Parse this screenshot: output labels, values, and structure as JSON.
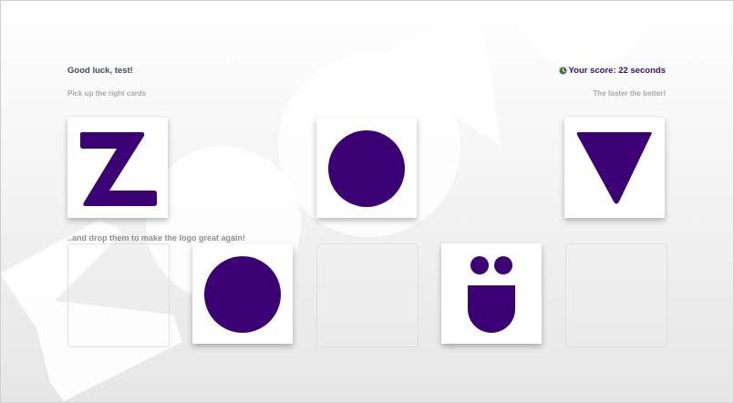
{
  "header": {
    "greeting": "Good luck, test!",
    "instruction": "Pick up the right cards",
    "score_text": "Your score: 22 seconds",
    "hint": "The faster the better!"
  },
  "drop_area": {
    "instruction": "..and drop them to make the logo great again!"
  },
  "pick_cards": [
    {
      "symbol": "letter-z"
    },
    {
      "symbol": "circle"
    },
    {
      "symbol": "triangle-down"
    }
  ],
  "drop_slots": [
    {
      "content": "empty"
    },
    {
      "content": "circle"
    },
    {
      "content": "empty"
    },
    {
      "content": "face-u"
    },
    {
      "content": "empty"
    }
  ],
  "colors": {
    "brand_purple": "#3b0073",
    "score_purple": "#3b0d73",
    "clock_green": "#3c7a3c"
  },
  "icons": {
    "score": "clock-icon"
  }
}
